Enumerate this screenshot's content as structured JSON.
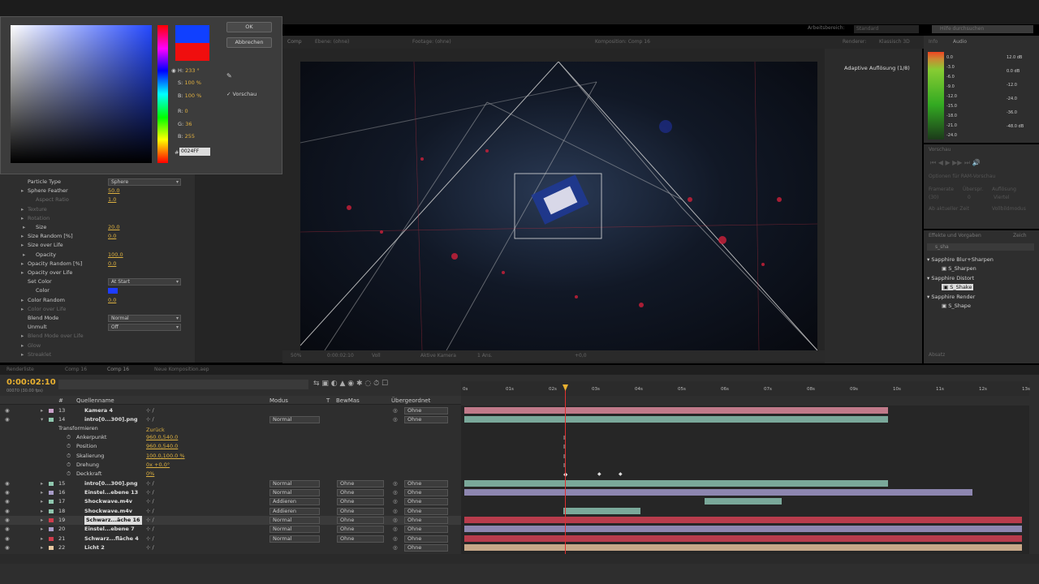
{
  "top": {
    "workspace_label": "Arbeitsbereich:",
    "workspace_value": "Standard",
    "search_placeholder": "Hilfe durchsuchen"
  },
  "color_picker": {
    "ok": "OK",
    "cancel": "Abbrechen",
    "preview": "Vorschau",
    "fields": [
      {
        "k": "H:",
        "v": "233 °"
      },
      {
        "k": "S:",
        "v": "100 %"
      },
      {
        "k": "B:",
        "v": "100 %"
      },
      {
        "k": "R:",
        "v": "0"
      },
      {
        "k": "G:",
        "v": "36"
      },
      {
        "k": "B:",
        "v": "255"
      }
    ],
    "hex_label": "#",
    "hex": "0024FF",
    "new_color": "#1040ff",
    "old_color": "#f00e0e"
  },
  "effect_controls": {
    "rows": [
      {
        "lbl": "Particle Type",
        "dd": "Sphere",
        "indent": 0
      },
      {
        "lbl": "Sphere Feather",
        "val": "50.0",
        "indent": 1,
        "tw": true
      },
      {
        "lbl": "Aspect Ratio",
        "val": "1.0",
        "indent": 2,
        "dim": true
      },
      {
        "lbl": "Texture",
        "indent": 1,
        "dim": true,
        "tw": true
      },
      {
        "lbl": "Rotation",
        "indent": 1,
        "dim": true,
        "tw": true
      },
      {
        "lbl": "Size",
        "val": "20.0",
        "indent": 2,
        "tw": true
      },
      {
        "lbl": "Size Random [%]",
        "val": "0.0",
        "indent": 1,
        "tw": true
      },
      {
        "lbl": "Size over Life",
        "indent": 1,
        "tw": true
      },
      {
        "lbl": "Opacity",
        "val": "100.0",
        "indent": 2,
        "tw": true
      },
      {
        "lbl": "Opacity Random [%]",
        "val": "0.0",
        "indent": 1,
        "tw": true
      },
      {
        "lbl": "Opacity over Life",
        "indent": 1,
        "tw": true
      },
      {
        "lbl": "Set Color",
        "dd": "At Start",
        "indent": 1
      },
      {
        "lbl": "Color",
        "swatch": "#1e3cff",
        "indent": 2
      },
      {
        "lbl": "Color Random",
        "val": "0.0",
        "indent": 1,
        "tw": true
      },
      {
        "lbl": "Color over Life",
        "indent": 1,
        "dim": true,
        "tw": true
      },
      {
        "lbl": "Blend Mode",
        "dd": "Normal",
        "indent": 1
      },
      {
        "lbl": "Unmult",
        "dd": "Off",
        "indent": 1
      },
      {
        "lbl": "Blend Mode over Life",
        "indent": 1,
        "dim": true,
        "tw": true
      },
      {
        "lbl": "Glow",
        "indent": 1,
        "dim": true,
        "tw": true
      },
      {
        "lbl": "Streaklet",
        "indent": 1,
        "dim": true,
        "tw": true
      }
    ]
  },
  "viewer": {
    "tabs": [
      "Ebene: (ohne)",
      "Footage: (ohne)",
      "Komposition: Comp 16"
    ],
    "tab_left": "Comp",
    "renderer_label": "Renderer:",
    "renderer_value": "Klassisch 3D",
    "resolution_label": "Adaptive Auflösung (1/8)",
    "footer": [
      "50%",
      "0:00:02:10",
      "Voll",
      "Aktive Kamera",
      "1 Ans.",
      "+0,0"
    ]
  },
  "audio": {
    "tabs": [
      "Info",
      "Audio"
    ],
    "left_scale": [
      "0.0",
      "-3.0",
      "-6.0",
      "-9.0",
      "-12.0",
      "-15.0",
      "-18.0",
      "-21.0",
      "-24.0"
    ],
    "right_scale": [
      "12.0 dB",
      "0.0 dB",
      "-12.0",
      "-24.0",
      "-36.0",
      "-48.0 dB"
    ]
  },
  "preview": {
    "title": "Vorschau",
    "option": "Optionen für RAM-Vorschau",
    "framerate_label": "Framerate",
    "skip_label": "Überspr.",
    "resolution_label": "Auflösung",
    "framerate": "(30)",
    "skip": "0",
    "resolution": "Viertel",
    "from_current": "Ab aktueller Zeit",
    "fullscreen": "Vollbildmodus"
  },
  "effects_panel": {
    "tabs": [
      "Effekte und Vorgaben",
      "Zeich"
    ],
    "search": "s_sha",
    "groups": [
      {
        "name": "Sapphire Blur+Sharpen",
        "items": [
          "S_Sharpen"
        ]
      },
      {
        "name": "Sapphire Distort",
        "items": [
          "S_Shake"
        ]
      },
      {
        "name": "Sapphire Render",
        "items": [
          "S_Shape"
        ]
      }
    ],
    "paragraph_tab": "Absatz"
  },
  "timeline": {
    "tabs": [
      "Renderliste",
      "Comp 16",
      "Comp 16",
      "Neue Komposition.aep"
    ],
    "timecode": "0:00:02:10",
    "fps": "00070 (30.00 fps)",
    "headers": [
      "#",
      "Quellenname",
      "Modus",
      "T",
      "BewMas",
      "Übergeordnet"
    ],
    "ruler": [
      "0s",
      "01s",
      "02s",
      "03s",
      "04s",
      "05s",
      "06s",
      "07s",
      "08s",
      "09s",
      "10s",
      "11s",
      "12s",
      "13s"
    ],
    "layers": [
      {
        "n": "13",
        "name": "Kamera 4",
        "color": "#c8a0c8",
        "mode": "",
        "trk": "",
        "par": "Ohne",
        "bar": [
          0,
          60
        ],
        "barcolor": "#c07a8a"
      },
      {
        "n": "14",
        "name": "intro[0...300].png",
        "color": "#8fc7ae",
        "mode": "Normal",
        "trk": "",
        "par": "Ohne",
        "bar": [
          0,
          60
        ],
        "barcolor": "#7aa89a"
      },
      {
        "n": "15",
        "name": "intro[0...300].png",
        "color": "#8fc7ae",
        "mode": "Normal",
        "trk": "Ohne",
        "par": "Ohne",
        "bar": [
          0,
          60
        ],
        "barcolor": "#7aa89a"
      },
      {
        "n": "16",
        "name": "Einstel...ebene 13",
        "color": "#a89cc8",
        "mode": "Normal",
        "trk": "Ohne",
        "par": "Ohne",
        "bar": [
          0,
          72
        ],
        "barcolor": "#8d86b0"
      },
      {
        "n": "17",
        "name": "Shockwave.m4v",
        "color": "#8fc7ae",
        "mode": "Addieren",
        "trk": "Ohne",
        "par": "Ohne",
        "bar": [
          34,
          45
        ],
        "barcolor": "#7aa89a"
      },
      {
        "n": "18",
        "name": "Shockwave.m4v",
        "color": "#8fc7ae",
        "mode": "Addieren",
        "trk": "Ohne",
        "par": "Ohne",
        "bar": [
          14,
          25
        ],
        "barcolor": "#7aa89a"
      },
      {
        "n": "19",
        "name": "Schwarz...äche 16",
        "color": "#d03c4c",
        "mode": "Normal",
        "trk": "Ohne",
        "par": "Ohne",
        "bar": [
          0,
          79
        ],
        "barcolor": "#b83c4c"
      },
      {
        "n": "20",
        "name": "Einstel...ebene 7",
        "color": "#a89cc8",
        "mode": "Normal",
        "trk": "Ohne",
        "par": "Ohne",
        "bar": [
          0,
          79
        ],
        "barcolor": "#8d86b0"
      },
      {
        "n": "21",
        "name": "Schwarz...fläche 4",
        "color": "#d03c4c",
        "mode": "Normal",
        "trk": "Ohne",
        "par": "Ohne",
        "bar": [
          0,
          79
        ],
        "barcolor": "#b83c4c"
      },
      {
        "n": "22",
        "name": "Licht 2",
        "color": "#e8c8a0",
        "mode": "",
        "trk": "",
        "par": "Ohne",
        "bar": [
          0,
          79
        ],
        "barcolor": "#c8a888"
      }
    ],
    "transform": {
      "label": "Transformieren",
      "reset": "Zurück",
      "props": [
        {
          "k": "Ankerpunkt",
          "v": "960.0,540.0"
        },
        {
          "k": "Position",
          "v": "960.0,540.0"
        },
        {
          "k": "Skalierung",
          "v": "100.0,100.0 %"
        },
        {
          "k": "Drehung",
          "v": "0x +0.0°"
        },
        {
          "k": "Deckkraft",
          "v": "0%"
        }
      ]
    }
  }
}
